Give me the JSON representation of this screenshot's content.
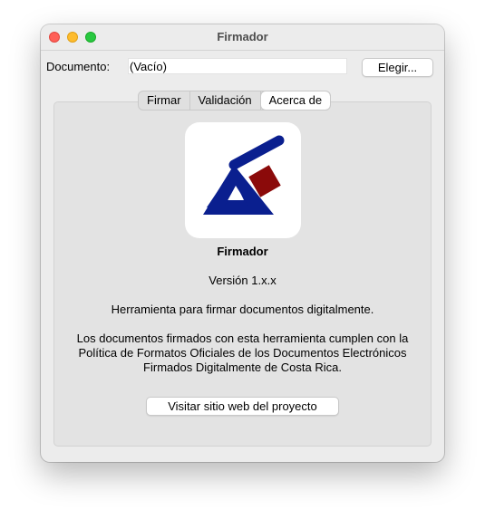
{
  "window": {
    "title": "Firmador"
  },
  "document": {
    "label": "Documento:",
    "value": "(Vacío)",
    "choose_label": "Elegir..."
  },
  "tabs": [
    {
      "label": "Firmar",
      "active": false
    },
    {
      "label": "Validación",
      "active": false
    },
    {
      "label": "Acerca de",
      "active": true
    }
  ],
  "about": {
    "logo_icon": "firmador-logo-icon",
    "logo_colors": {
      "primary": "#0a1f8f",
      "accent": "#8b0a0a"
    },
    "app_name": "Firmador",
    "version": "Versión 1.x.x",
    "description": "Herramienta para firmar documentos digitalmente.",
    "compliance_lines": [
      "Los documentos firmados con esta herramienta cumplen con la",
      "Política de Formatos Oficiales de los Documentos Electrónicos",
      "Firmados Digitalmente de Costa Rica."
    ],
    "visit_label": "Visitar sitio web del proyecto"
  }
}
